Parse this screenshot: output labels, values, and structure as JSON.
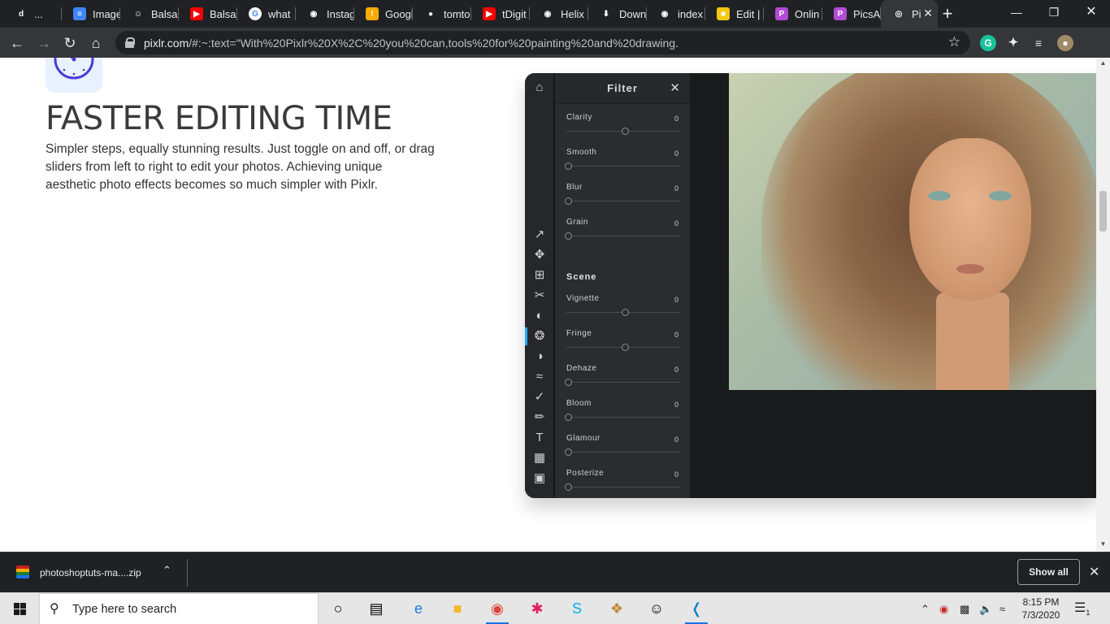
{
  "browser": {
    "tabs": [
      {
        "label": "...",
        "icon": "tiktok-icon",
        "color": "#202124",
        "glyph": "d"
      },
      {
        "label": "Image",
        "icon": "docs-icon",
        "color": "#4285f4",
        "glyph": "≡"
      },
      {
        "label": "Balsar",
        "icon": "smiley-icon",
        "color": "#202124",
        "glyph": "☺"
      },
      {
        "label": "Balsar",
        "icon": "youtube-icon",
        "color": "#ff0000",
        "glyph": "▶"
      },
      {
        "label": "what",
        "icon": "google-icon",
        "color": "#ffffff",
        "glyph": "G"
      },
      {
        "label": "Instag",
        "icon": "globe-icon",
        "color": "#202124",
        "glyph": "◉"
      },
      {
        "label": "Googl",
        "icon": "keep-icon",
        "color": "#f9ab00",
        "glyph": "!"
      },
      {
        "label": "tomto",
        "icon": "github-icon",
        "color": "#202124",
        "glyph": "●"
      },
      {
        "label": "tDigit",
        "icon": "youtube-icon",
        "color": "#ff0000",
        "glyph": "▶"
      },
      {
        "label": "Helix",
        "icon": "globe-icon",
        "color": "#202124",
        "glyph": "◉"
      },
      {
        "label": "Down",
        "icon": "download-icon",
        "color": "#202124",
        "glyph": "⬇"
      },
      {
        "label": "index",
        "icon": "globe-icon",
        "color": "#202124",
        "glyph": "◉"
      },
      {
        "label": "Edit |",
        "icon": "edit-app-icon",
        "color": "#f2c811",
        "glyph": "■"
      },
      {
        "label": "Onlin",
        "icon": "picsart-icon",
        "color": "#b44ad6",
        "glyph": "P"
      },
      {
        "label": "PicsA",
        "icon": "picsart-icon",
        "color": "#b44ad6",
        "glyph": "P"
      },
      {
        "label": "Pi",
        "icon": "pixlr-icon",
        "color": "#35363a",
        "glyph": "◎"
      }
    ],
    "url_host": "pixlr.com",
    "url_rest": "/#:~:text=\"With%20Pixlr%20X%2C%20you%20can,tools%20for%20painting%20and%20drawing."
  },
  "page": {
    "headline": "FASTER EDITING TIME",
    "description": "Simpler steps, equally stunning results. Just toggle on and off, or drag sliders from left to right to edit your photos. Achieving unique aesthetic photo effects becomes so much simpler with Pixlr."
  },
  "editor": {
    "panel_title": "Filter",
    "section_scene": "Scene",
    "sliders": [
      {
        "label": "Clarity",
        "value": "0",
        "position": 0.5
      },
      {
        "label": "Smooth",
        "value": "0",
        "position": 0.0
      },
      {
        "label": "Blur",
        "value": "0",
        "position": 0.0
      },
      {
        "label": "Grain",
        "value": "0",
        "position": 0.0
      },
      {
        "label": "Vignette",
        "value": "0",
        "position": 0.5
      },
      {
        "label": "Fringe",
        "value": "0",
        "position": 0.5
      },
      {
        "label": "Dehaze",
        "value": "0",
        "position": 0.0
      },
      {
        "label": "Bloom",
        "value": "0",
        "position": 0.0
      },
      {
        "label": "Glamour",
        "value": "0",
        "position": 0.0
      },
      {
        "label": "Posterize",
        "value": "0",
        "position": 0.0
      }
    ]
  },
  "downloads": {
    "filename": "photoshoptuts-ma....zip",
    "show_all": "Show all"
  },
  "taskbar": {
    "search_placeholder": "Type here to search",
    "time": "8:15 PM",
    "date": "7/3/2020",
    "notification_count": "1"
  }
}
